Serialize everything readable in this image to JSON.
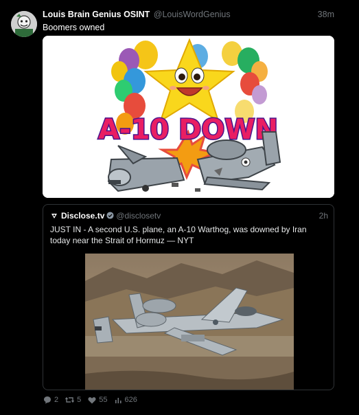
{
  "tweet": {
    "author_name": "Louis Brain Genius OSINT",
    "author_handle": "@LouisWordGenius",
    "time": "38m",
    "text": "Boomers owned",
    "image_caption": "A-10 DOWN"
  },
  "quote": {
    "author_name": "Disclose.tv",
    "author_handle": "@disclosetv",
    "time": "2h",
    "text": "JUST IN -  A second U.S. plane, an A-10 Warthog, was downed by Iran today near the Strait of Hormuz — NYT"
  },
  "actions": {
    "replies": "2",
    "retweets": "5",
    "likes": "55",
    "views": "626"
  },
  "colors": {
    "background": "#000000",
    "text_primary": "#e7e9ea",
    "text_secondary": "#71767b",
    "border": "#2f3336",
    "verified": "#8b98a5"
  },
  "icons": [
    "reply-icon",
    "retweet-icon",
    "like-icon",
    "views-icon",
    "disclose-logo-icon",
    "verified-icon"
  ]
}
